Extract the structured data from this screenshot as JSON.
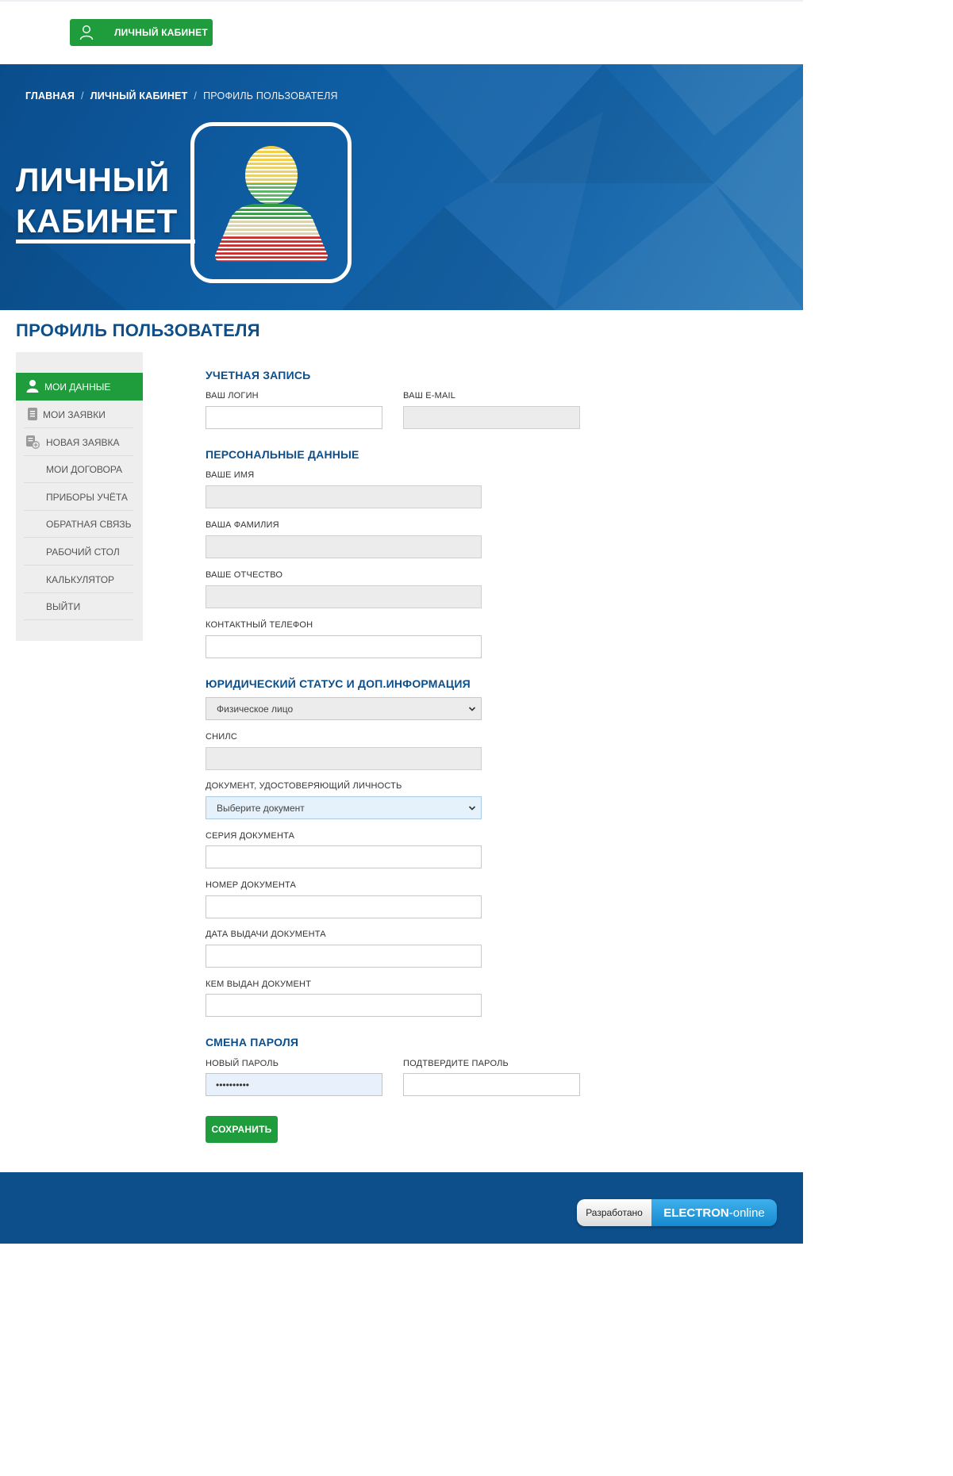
{
  "header": {
    "cabinet_button": "ЛИЧНЫЙ КАБИНЕТ"
  },
  "hero": {
    "breadcrumb": {
      "home": "ГЛАВНАЯ",
      "sep": "/",
      "cabinet": "ЛИЧНЫЙ КАБИНЕТ",
      "current": "ПРОФИЛЬ ПОЛЬЗОВАТЕЛЯ"
    },
    "title_line1": "ЛИЧНЫЙ",
    "title_line2": "КАБИНЕТ"
  },
  "page": {
    "title": "ПРОФИЛЬ ПОЛЬЗОВАТЕЛЯ"
  },
  "sidebar": {
    "items": [
      {
        "label": "МОИ ДАННЫЕ",
        "icon": "user-icon",
        "active": true
      },
      {
        "label": "МОИ ЗАЯВКИ",
        "icon": "document-icon"
      },
      {
        "label": "НОВАЯ ЗАЯВКА",
        "icon": "new-document-icon"
      },
      {
        "label": "МОИ ДОГОВОРА"
      },
      {
        "label": "ПРИБОРЫ УЧЁТА"
      },
      {
        "label": "ОБРАТНАЯ СВЯЗЬ"
      },
      {
        "label": "РАБОЧИЙ СТОЛ"
      },
      {
        "label": "КАЛЬКУЛЯТОР"
      },
      {
        "label": "ВЫЙТИ"
      }
    ]
  },
  "form": {
    "account": {
      "title": "УЧЕТНАЯ ЗАПИСЬ",
      "login_label": "ВАШ ЛОГИН",
      "login_value": "",
      "email_label": "ВАШ E-MAIL",
      "email_value": ""
    },
    "personal": {
      "title": "ПЕРСОНАЛЬНЫЕ ДАННЫЕ",
      "name_label": "ВАШЕ ИМЯ",
      "surname_label": "ВАША ФАМИЛИЯ",
      "patronymic_label": "ВАШЕ ОТЧЕСТВО",
      "phone_label": "КОНТАКТНЫЙ ТЕЛЕФОН"
    },
    "legal": {
      "title": "ЮРИДИЧЕСКИЙ СТАТУС И ДОП.ИНФОРМАЦИЯ",
      "status_value": "Физическое лицо",
      "snils_label": "СНИЛС",
      "document_label": "ДОКУМЕНТ, УДОСТОВЕРЯЮЩИЙ ЛИЧНОСТЬ",
      "document_value": "Выберите документ",
      "series_label": "СЕРИЯ ДОКУМЕНТА",
      "number_label": "НОМЕР ДОКУМЕНТА",
      "issue_date_label": "ДАТА ВЫДАЧИ ДОКУМЕНТА",
      "issued_by_label": "КЕМ ВЫДАН ДОКУМЕНТ"
    },
    "password": {
      "title": "СМЕНА ПАРОЛЯ",
      "new_label": "НОВЫЙ ПАРОЛЬ",
      "new_value": "••••••••••",
      "confirm_label": "ПОДТВЕРДИТЕ ПАРОЛЬ",
      "confirm_value": ""
    },
    "save_button": "СОХРАНИТЬ"
  },
  "footer": {
    "developed_by": "Разработано",
    "brand_bold": "ELECTRON",
    "brand_rest": "-online"
  },
  "colors": {
    "accent_green": "#1f9d3c",
    "brand_blue": "#0c4f8b"
  }
}
